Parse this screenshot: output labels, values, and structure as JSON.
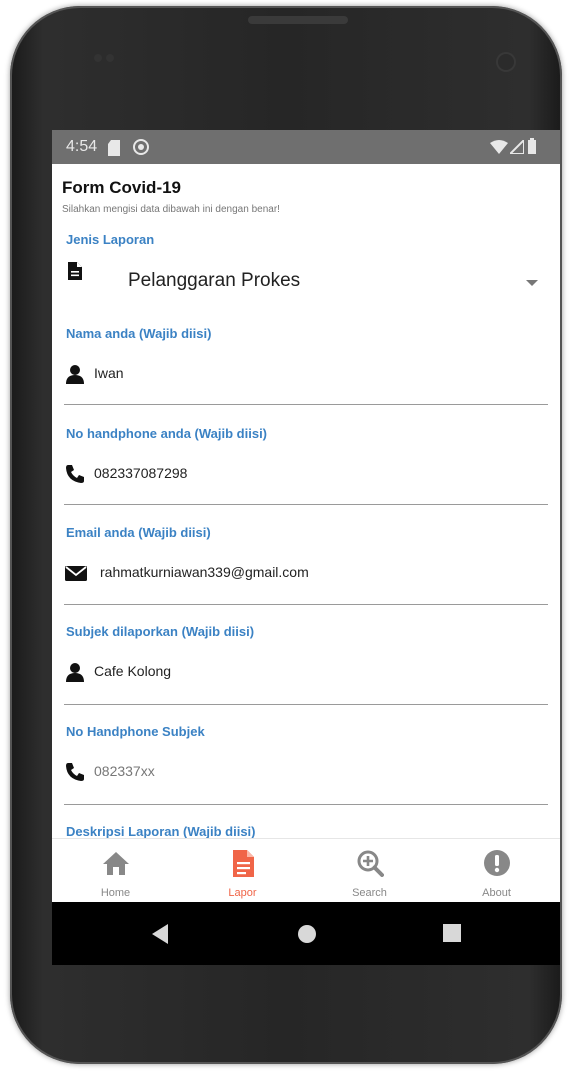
{
  "status_bar": {
    "time": "4:54"
  },
  "form": {
    "title": "Form Covid-19",
    "subtitle": "Silahkan mengisi data dibawah ini dengan benar!",
    "report_type": {
      "label": "Jenis Laporan",
      "selected": "Pelanggaran Prokes"
    },
    "fields": [
      {
        "label": "Nama anda (Wajib diisi)",
        "value": "Iwan",
        "icon": "person-icon"
      },
      {
        "label": "No handphone anda (Wajib diisi)",
        "value": "082337087298",
        "icon": "phone-icon"
      },
      {
        "label": "Email anda (Wajib diisi)",
        "value": "rahmatkurniawan339@gmail.com",
        "icon": "envelope-icon"
      },
      {
        "label": "Subjek dilaporkan (Wajib diisi)",
        "value": "Cafe Kolong",
        "icon": "person-icon"
      },
      {
        "label": "No Handphone Subjek",
        "placeholder": "082337xx",
        "icon": "phone-icon"
      },
      {
        "label": "Deskripsi Laporan (Wajib diisi)"
      }
    ]
  },
  "tabs": [
    {
      "label": "Home",
      "icon": "home-icon",
      "active": false
    },
    {
      "label": "Lapor",
      "icon": "document-icon",
      "active": true
    },
    {
      "label": "Search",
      "icon": "zoom-in-icon",
      "active": false
    },
    {
      "label": "About",
      "icon": "exclamation-icon",
      "active": false
    }
  ],
  "colors": {
    "accent": "#3b82c4",
    "active_tab": "#f06548",
    "inactive_tab": "#888888",
    "status_bar": "#6f6f6f"
  }
}
